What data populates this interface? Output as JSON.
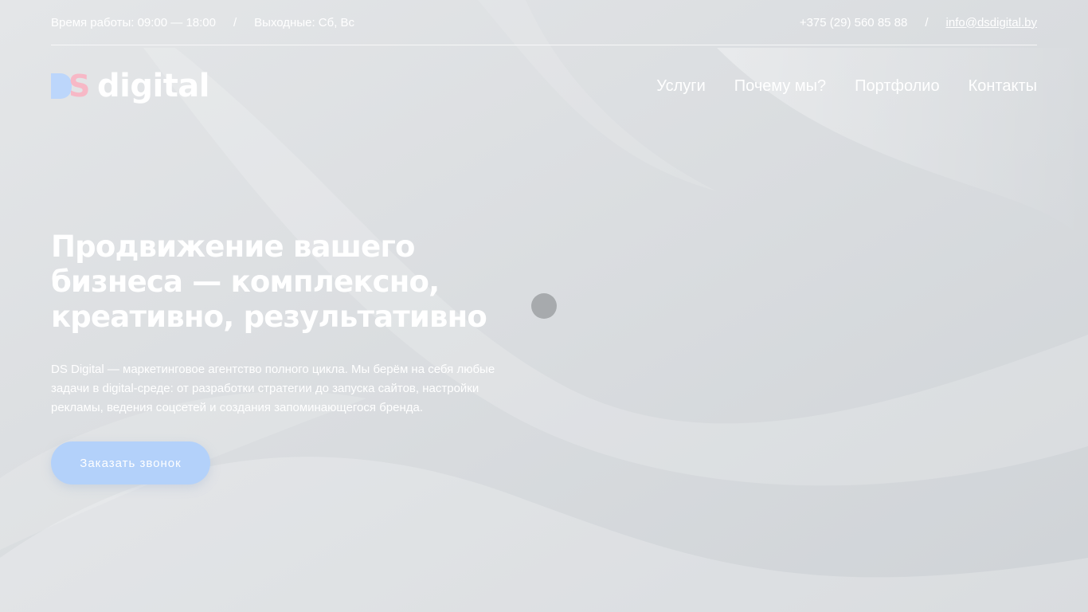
{
  "topbar": {
    "hours": "Время работы: 09:00 — 18:00",
    "separator": "/",
    "days_off": "Выходные: Сб, Вс",
    "phone": "+375 (29) 560 85 88",
    "email": "info@dsdigital.by"
  },
  "header": {
    "logo_text": "digital",
    "logo_letter_s": "S",
    "nav": [
      "Услуги",
      "Почему мы?",
      "Портфолио",
      "Контакты"
    ]
  },
  "hero": {
    "title": "Продвижение вашего бизнеса — комплексно, креативно, результативно",
    "description": "DS Digital — маркетинговое агентство полного цикла. Мы берём на себя любые задачи в digital-среде: от разработки стратегии до запуска сайтов, настройки рекламы, ведения соцсетей и создания запоминающегося бренда.",
    "cta_label": "Заказать звонок"
  },
  "colors": {
    "background": "#d5d9dd",
    "logo_blue": "#bcd6fb",
    "logo_pink": "#f7b8c6",
    "cta": "#b3d1fa",
    "loader": "#a7aaad"
  }
}
